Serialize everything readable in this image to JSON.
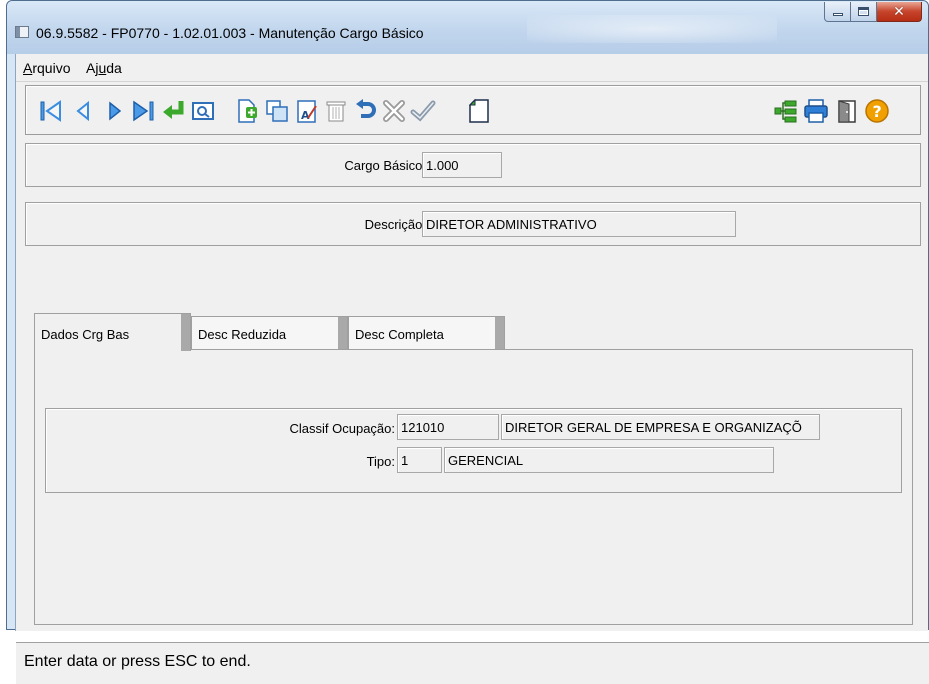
{
  "window": {
    "title": "06.9.5582 - FP0770 - 1.02.01.003 - Manutenção Cargo Básico"
  },
  "menu": {
    "arquivo_prefix": "A",
    "arquivo_rest": "rquivo",
    "ajuda_prefix": "Aj",
    "ajuda_u": "u",
    "ajuda_rest": "da"
  },
  "toolbar": {
    "buttons": [
      "first-record",
      "previous-record",
      "next-record",
      "last-record",
      "return",
      "view",
      "new",
      "copy",
      "edit",
      "delete",
      "undo",
      "cancel",
      "confirm",
      "new-document",
      "tree",
      "print",
      "exit",
      "help"
    ]
  },
  "form": {
    "cargo_basico_label": "Cargo Básico:",
    "cargo_basico_value": "1.000",
    "descricao_label": "Descrição:",
    "descricao_value": "DIRETOR ADMINISTRATIVO"
  },
  "tabs": [
    {
      "label": "Dados Crg Bas",
      "active": true
    },
    {
      "label": "Desc Reduzida",
      "active": false
    },
    {
      "label": "Desc Completa",
      "active": false
    }
  ],
  "dados": {
    "classif_label": "Classif Ocupação:",
    "classif_code": "121010",
    "classif_desc": "DIRETOR GERAL DE EMPRESA E ORGANIZAÇÕ",
    "tipo_label": "Tipo:",
    "tipo_code": "1",
    "tipo_desc": "GERENCIAL"
  },
  "status": {
    "text": "Enter data or press ESC to end."
  },
  "colors": {
    "titlebar": "#c3d7ee",
    "close_button": "#c6442b",
    "arrow_blue": "#3a8de0",
    "return_green": "#3ca82c",
    "help_orange": "#f0a000"
  }
}
